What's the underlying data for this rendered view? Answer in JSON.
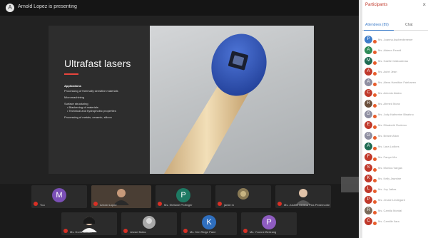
{
  "header": {
    "presenting_text": "Arnold Lopez is presenting",
    "presenter_initial": "A"
  },
  "slide": {
    "title": "Ultrafast lasers",
    "heading": "Applications",
    "items": [
      "Processing of thermally sensitive materials",
      "Micromachining",
      "Surface structuring",
      "Processing of metals, ceramic, silicon"
    ],
    "sub_items": [
      "Blackening of materials",
      "Technical and hydrophobic properties"
    ]
  },
  "strip": {
    "tiles": [
      {
        "initial": "M",
        "name": "You",
        "color": "#7b4fb6",
        "type": "avatar"
      },
      {
        "initial": "",
        "name": "Arnold Lopez",
        "color": "#3a3a3a",
        "type": "camera"
      },
      {
        "initial": "P",
        "name": "Ms. Stefanie Profinger",
        "color": "#1e7a63",
        "type": "avatar"
      },
      {
        "initial": "",
        "name": "jamie m",
        "color": "#3a3a3a",
        "type": "camera"
      },
      {
        "initial": "",
        "name": "Ms. Justine Mellina Flos Pedemonte",
        "color": "#3a3a3a",
        "type": "camera"
      },
      {
        "initial": "",
        "name": "Ms. Doris Nelson",
        "color": "#3a3a3a",
        "type": "camera"
      },
      {
        "initial": "",
        "name": "Jessie Bolas",
        "color": "#3a3a3a",
        "type": "camera"
      },
      {
        "initial": "K",
        "name": "Ms. Kim Ridge Pane",
        "color": "#2f6fbf",
        "type": "avatar"
      },
      {
        "initial": "P",
        "name": "Ms. Yvonne Bertrang",
        "color": "#8e5cc0",
        "type": "avatar"
      }
    ]
  },
  "panel": {
    "title": "Participants",
    "close_label": "×",
    "tab_attendees": "Attendees (89)",
    "tab_chat": "Chat",
    "participants": [
      {
        "initial": "P",
        "color": "#3d7cc9",
        "name": "Ms. Joanna Aschenbreener"
      },
      {
        "initial": "A",
        "color": "#2e8b57",
        "name": "Ms. Aideen Ferrell"
      },
      {
        "initial": "M",
        "color": "#1f6b52",
        "name": "Ms. Gaelle Galloudreau"
      },
      {
        "initial": "A",
        "color": "#c0392b",
        "name": "Ms. Aubri Jean"
      },
      {
        "initial": "A",
        "color": "#8e8ea0",
        "name": "Ms. Alexa Hamilton Fairhaven"
      },
      {
        "initial": "C",
        "color": "#c0392b",
        "name": "Ms. Antonio Alaino"
      },
      {
        "initial": "R",
        "color": "#6b4f3b",
        "name": "Ms. Ahmed Monz"
      },
      {
        "initial": "G",
        "color": "#8e8ea0",
        "name": "Ms. Jody Katherine Bisahno"
      },
      {
        "initial": "E",
        "color": "#c0392b",
        "name": "Ms. Elisabeth Rodemo"
      },
      {
        "initial": "G",
        "color": "#8e8ea0",
        "name": "Ms. Briane Alton"
      },
      {
        "initial": "A",
        "color": "#1f6b52",
        "name": "Ms. Lara Lodkes"
      },
      {
        "initial": "F",
        "color": "#c0392b",
        "name": "Ms. Fanya Vitz"
      },
      {
        "initial": "S",
        "color": "#c0392b",
        "name": "Ms. Monica Vargas"
      },
      {
        "initial": "K",
        "color": "#c0392b",
        "name": "Ms. Kelly Jasmine"
      },
      {
        "initial": "L",
        "color": "#c0392b",
        "name": "Ms. Joy Jatlas"
      },
      {
        "initial": "P",
        "color": "#c0392b",
        "name": "Ms. Jessie Lindegard"
      },
      {
        "initial": "R",
        "color": "#7a6a5a",
        "name": "Ms. Camila Montal"
      },
      {
        "initial": "C",
        "color": "#c0392b",
        "name": "Ms. Camille Ilara"
      }
    ]
  }
}
